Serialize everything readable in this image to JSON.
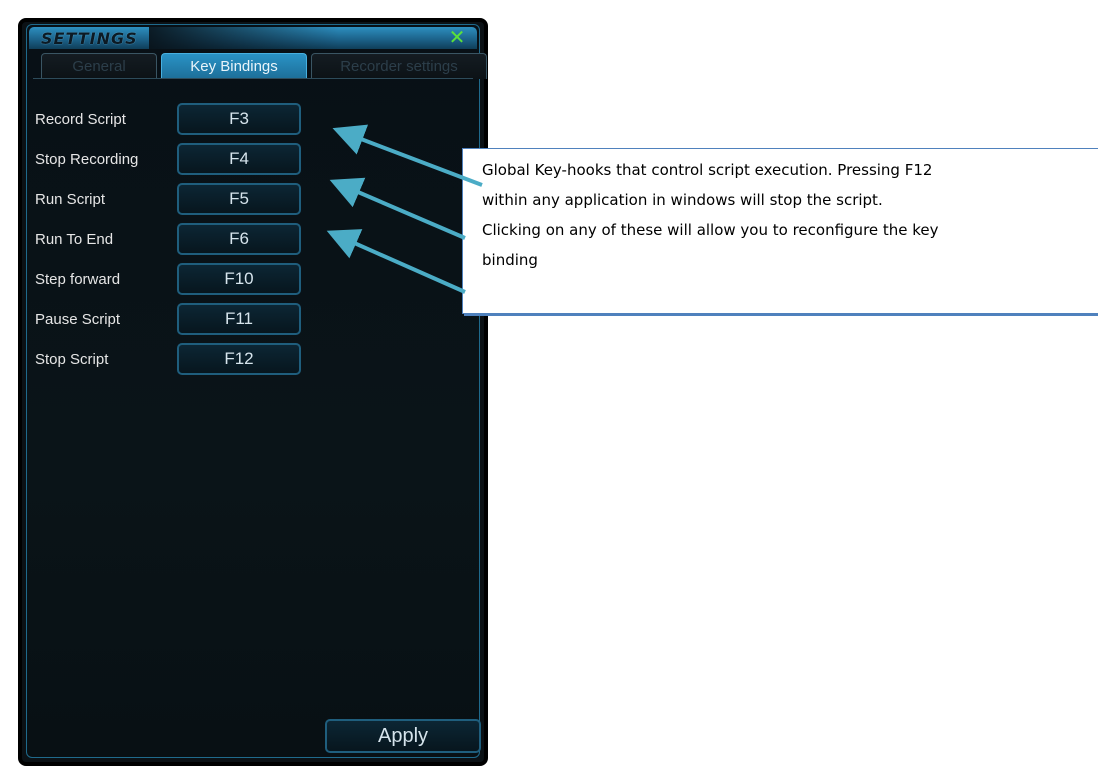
{
  "window": {
    "title": "SETTINGS",
    "close_icon": "close-icon",
    "tabs": [
      {
        "label": "General",
        "active": false
      },
      {
        "label": "Key Bindings",
        "active": true
      },
      {
        "label": "Recorder settings",
        "active": false
      }
    ]
  },
  "bindings": [
    {
      "label": "Record Script",
      "key": "F3"
    },
    {
      "label": "Stop Recording",
      "key": "F4"
    },
    {
      "label": "Run Script",
      "key": "F5"
    },
    {
      "label": "Run To End",
      "key": "F6"
    },
    {
      "label": "Step forward",
      "key": "F10"
    },
    {
      "label": "Pause Script",
      "key": "F11"
    },
    {
      "label": "Stop Script",
      "key": "F12"
    }
  ],
  "apply_label": "Apply",
  "callout": {
    "lines": [
      "Global Key-hooks that control script execution. Pressing F12",
      "within any application in windows will stop the script.",
      "Clicking on any of these will allow you to reconfigure the key",
      "binding"
    ]
  },
  "colors": {
    "accent": "#2a93c6",
    "close": "#5be13a",
    "arrow": "#4bacc6",
    "callout_border": "#4f81bd"
  }
}
